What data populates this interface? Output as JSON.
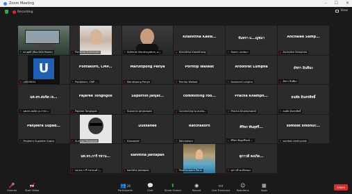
{
  "window": {
    "title": "Zoom Meeting",
    "controls": [
      "–",
      "☐",
      "✕"
    ]
  },
  "header": {
    "recording_label": "Recording",
    "view_label": "View"
  },
  "tiles": [
    {
      "name": "",
      "label": "ดร.ยุทธ์ (ห้อง DSA Room)",
      "video": "room",
      "active": true
    },
    {
      "name": "",
      "label": "Pornthip Sunmanee",
      "video": "face1"
    },
    {
      "name": "",
      "label": "Suthirak Monthayothin, ผ...",
      "video": "face2"
    },
    {
      "name": "Khanittha Kaew...",
      "label": "Khanittha Kaewthong",
      "video": ""
    },
    {
      "name": "จันทรา แ...ญชมา",
      "label": "จันทรา แจงชมา",
      "video": ""
    },
    {
      "name": "Anchalee Samp...",
      "label": "Anchalee Sampheo",
      "video": ""
    },
    {
      "name": "",
      "label": "u0006032",
      "video": "avatar-u",
      "letter": "U"
    },
    {
      "name": "Pontakorn, CMP...",
      "label": "Pontakorn, CMP ...",
      "video": ""
    },
    {
      "name": "Maruttpong Panya",
      "label": "Maruttpong Panya",
      "video": ""
    },
    {
      "name": "Porntip Walwat",
      "label": "Porntip Walwat",
      "video": ""
    },
    {
      "name": "Aroonrat Lumpha",
      "label": "Aroonrat Lumpha",
      "video": ""
    },
    {
      "name": "อัชรา อินทิมะ",
      "label": "อัชรา อินทิมะ",
      "video": ""
    },
    {
      "name": "มศ.ทร.สมจิต เจ...",
      "label": "มศ.ทร.สมจิต เจ.ราชว...",
      "video": ""
    },
    {
      "name": "Pajaree Tongngok",
      "label": "Pajaree Tongngok",
      "video": ""
    },
    {
      "name": "Supornin Janjar...",
      "label": "Supornin Janjarasak",
      "video": ""
    },
    {
      "name": "committing roo...",
      "label": "Connecting to audio...",
      "video": ""
    },
    {
      "name": "Pracha Khamph...",
      "label": "Pracha Khamphaichi",
      "video": ""
    },
    {
      "name": "ธนพัล อินทรสิทธิ์",
      "label": "ธนพัล อินทรสิทธิ์",
      "video": ""
    },
    {
      "name": "Panjeera Supad...",
      "label": "Panjeera Supadee Gupta",
      "video": ""
    },
    {
      "name": "",
      "label": "Suriyan Thaiwand",
      "video": "bw"
    },
    {
      "name": "Dussanee",
      "label": "Dussanee",
      "video": ""
    },
    {
      "name": "Ratchakorn",
      "label": "Ratchakorn",
      "video": ""
    },
    {
      "name": "ศิริพร พันธุศรี...",
      "label": "ศิริพร พันธุศรีพงษ์ ...",
      "video": ""
    },
    {
      "name": "sombat sindhuc...",
      "label": "sombat sindhuchat",
      "video": ""
    },
    {
      "name": "",
      "label": "",
      "video": "empty"
    },
    {
      "name": "มศ.ทร.การี รหาน...",
      "label": "มศ.ทร.การี รหานนท์ (...",
      "video": ""
    },
    {
      "name": "kanittha Jantapan",
      "label": "kanittha Jantapan",
      "video": ""
    },
    {
      "name": "",
      "label": "Youthsniparh Paris",
      "video": "pool"
    },
    {
      "name": "สุภาวดี คงเกิด...",
      "label": "สุภาวดี คงเกิดทอง",
      "video": ""
    },
    {
      "name": "",
      "label": "",
      "video": "empty"
    }
  ],
  "toolbar": {
    "unmute": "Unmute",
    "start_video": "Start Video",
    "participants": "Participants",
    "participants_count": "28",
    "chat": "Chat",
    "share_screen": "Share Screen",
    "record": "Record",
    "live_transcript": "Live Transcript",
    "reactions": "Reactions",
    "apps": "Apps",
    "leave": "Leave"
  },
  "colors": {
    "accent": "#2d8cff",
    "mute_red": "#e02828",
    "active_border": "#d4d64c"
  }
}
